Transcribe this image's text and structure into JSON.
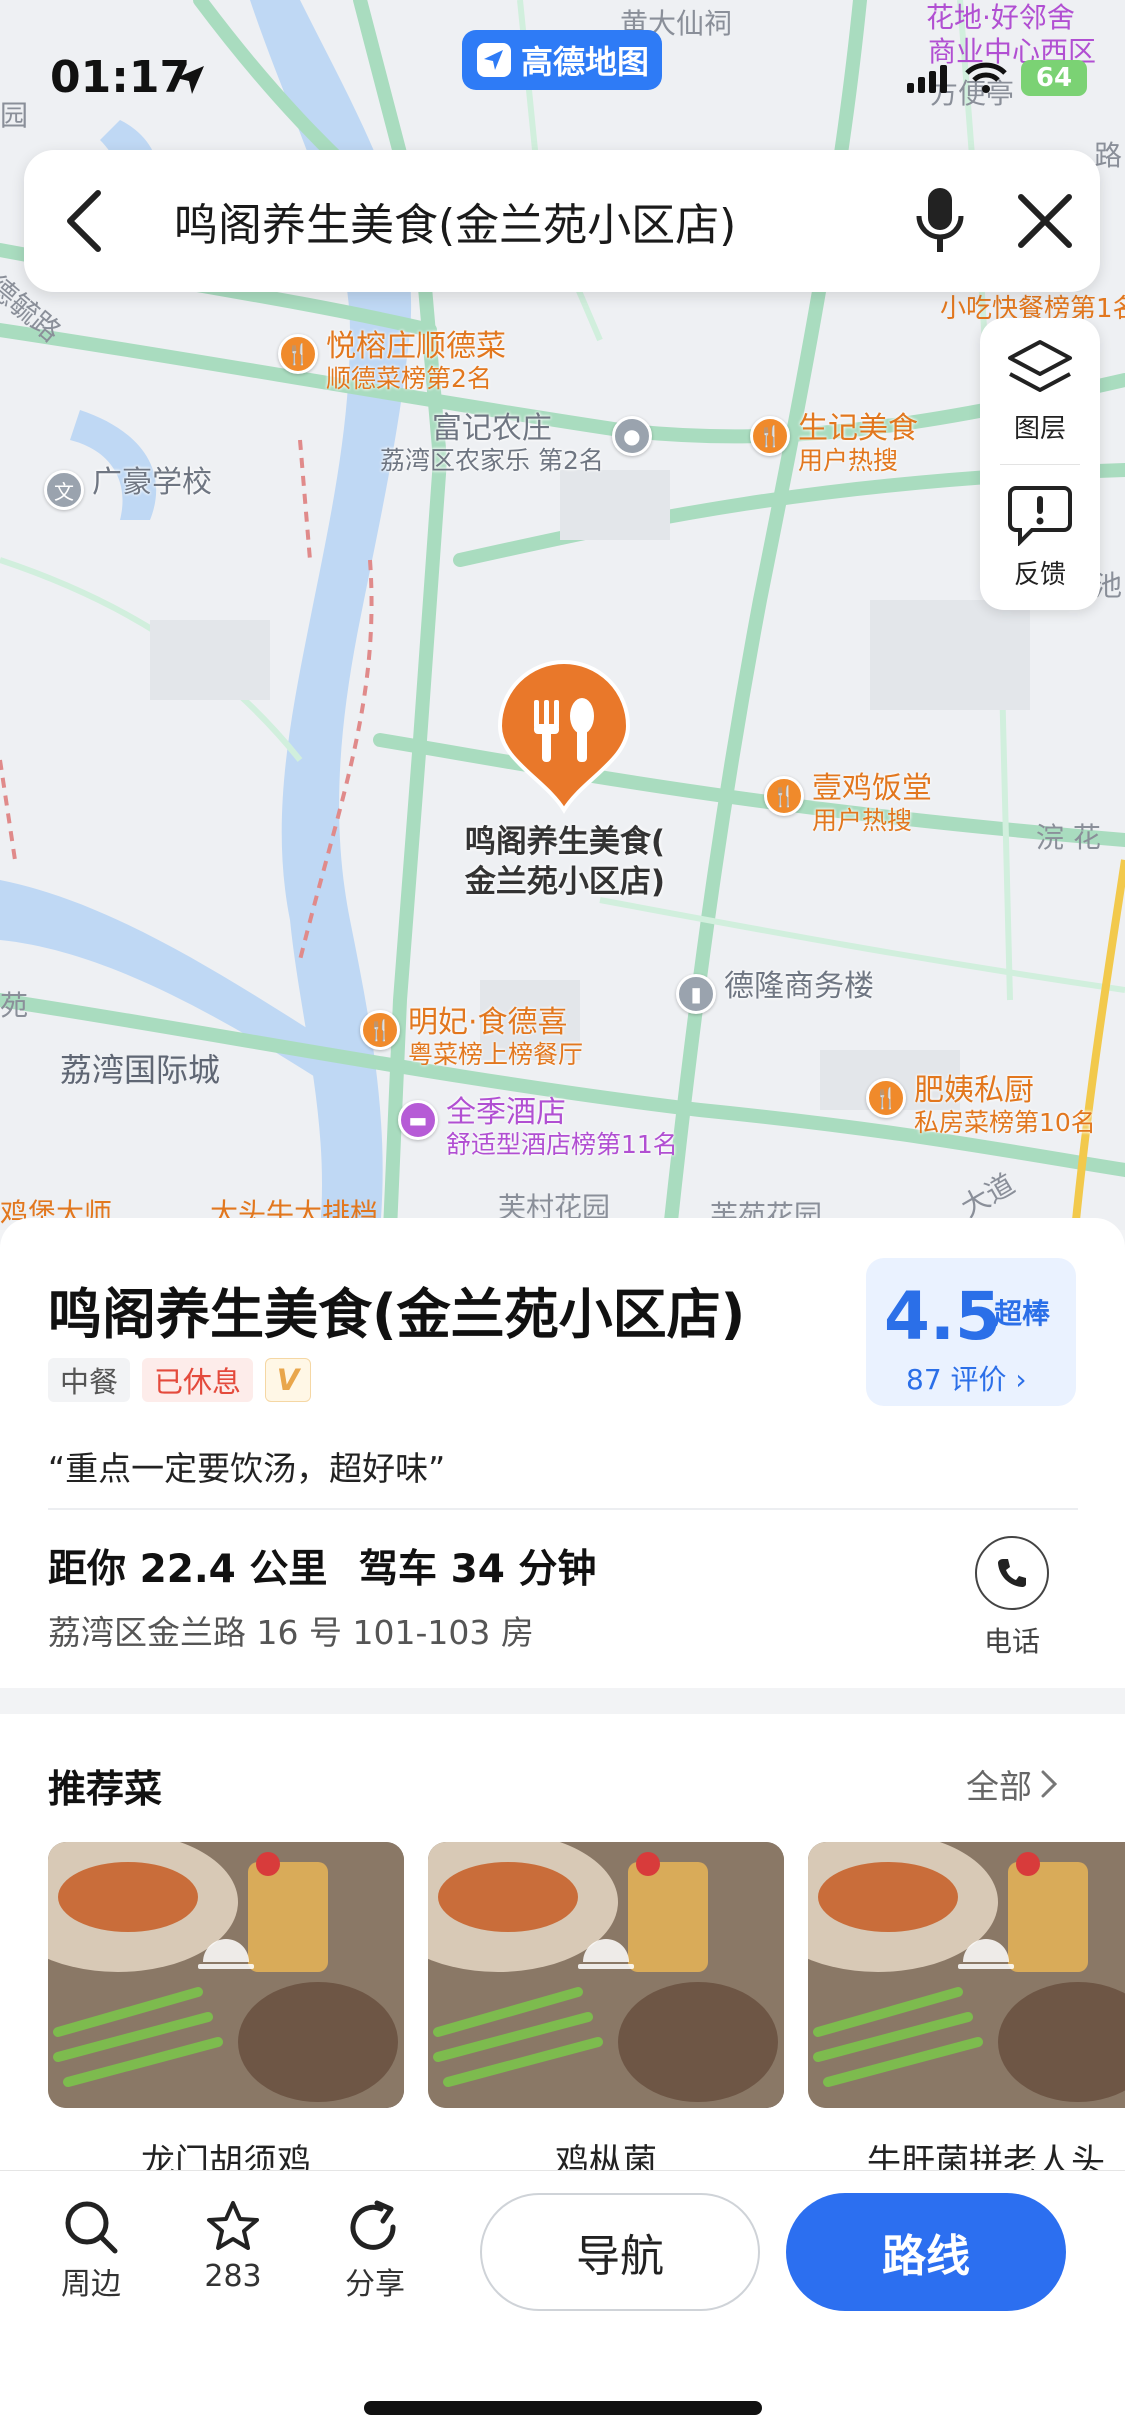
{
  "status_bar": {
    "time": "01:17",
    "battery": "64"
  },
  "app_badge": {
    "label": "高德地图"
  },
  "search": {
    "query": "鸣阁养生美食(金兰苑小区店)"
  },
  "side_tools": {
    "layers_label": "图层",
    "feedback_label": "反馈"
  },
  "map": {
    "labels": {
      "huangdaxian": "黄大仙祠",
      "commercial": "商业中心西区",
      "huadi": "花地·好邻舍",
      "fangbian": "方便亭",
      "yuan": "园",
      "lu": "路",
      "dishui": "德毓路",
      "xiaochi": "小吃快餐榜第1名",
      "guanghao": "广豪学校",
      "lixiang": "荔湾国际城",
      "yuan2": "苑",
      "huanghua": "浣 花",
      "chi": "池",
      "furong": "芙村花园",
      "yuyuan": "芙苑花园",
      "dadao": "大道",
      "jibao": "鸡堡大师",
      "dabu": "大头牛大排档"
    },
    "pois": {
      "yuerong": {
        "name": "悦榕庄顺德菜",
        "sub": "顺德菜榜第2名"
      },
      "fuji": {
        "name": "富记农庄",
        "sub": "荔湾区农家乐 第2名"
      },
      "shengji": {
        "name": "生记美食",
        "sub": "用户热搜"
      },
      "yiji": {
        "name": "壹鸡饭堂",
        "sub": "用户热搜"
      },
      "delong": {
        "name": "德隆商务楼"
      },
      "mingfei": {
        "name": "明妃·食德喜",
        "sub": "粤菜榜上榜餐厅"
      },
      "quanji": {
        "name": "全季酒店",
        "sub": "舒适型酒店榜第11名"
      },
      "feiyi": {
        "name": "肥姨私厨",
        "sub": "私房菜榜第10名"
      }
    },
    "main_pin": {
      "line1": "鸣阁养生美食(",
      "line2": "金兰苑小区店)"
    }
  },
  "place": {
    "title": "鸣阁养生美食(金兰苑小区店)",
    "tags": {
      "category": "中餐",
      "status": "已休息",
      "v": "V"
    },
    "rating": {
      "score": "4.5",
      "word": "超棒",
      "count": "87 评价 ›"
    },
    "quote": "“重点一定要饮汤，超好味”",
    "distance_prefix": "距你",
    "distance": "22.4 公里",
    "drive_prefix": "驾车",
    "drive_time": "34 分钟",
    "address": "荔湾区金兰路 16 号 101-103 房",
    "phone_label": "电话"
  },
  "dishes": {
    "title": "推荐菜",
    "all_label": "全部",
    "items": [
      {
        "name": "龙门胡须鸡"
      },
      {
        "name": "鸡枞菌"
      },
      {
        "name": "牛肝菌拼老人头"
      }
    ]
  },
  "bottom_bar": {
    "nearby": "周边",
    "favorites_count": "283",
    "share": "分享",
    "navigate": "导航",
    "route": "路线"
  },
  "colors": {
    "accent": "#2c6ff0",
    "poi_orange": "#f08a2b",
    "closed_red": "#e44a3c",
    "rating_blue": "#2b6fe8"
  }
}
